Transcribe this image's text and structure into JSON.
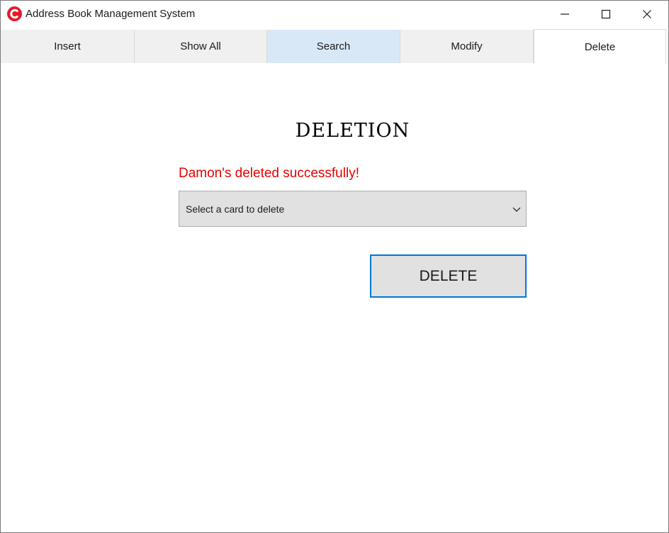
{
  "window": {
    "title": "Address Book Management System"
  },
  "tabs": [
    {
      "label": "Insert"
    },
    {
      "label": "Show All"
    },
    {
      "label": "Search"
    },
    {
      "label": "Modify"
    },
    {
      "label": "Delete"
    }
  ],
  "tab_state": {
    "selected": "Delete",
    "hovered": "Search"
  },
  "deletion": {
    "heading": "DELETION",
    "status_message": "Damon's deleted successfully!",
    "card_select": {
      "placeholder": "Select a card to delete"
    },
    "delete_button_label": "DELETE"
  },
  "colors": {
    "status_message": "#e60000",
    "focus_border": "#0078d7",
    "tab_hover": "#d9e8f7",
    "app_icon": "#e21b2b"
  },
  "icons": {
    "app": "app-logo-icon",
    "minimize": "minimize-icon",
    "maximize": "maximize-icon",
    "close": "close-icon",
    "dropdown": "chevron-down-icon"
  }
}
